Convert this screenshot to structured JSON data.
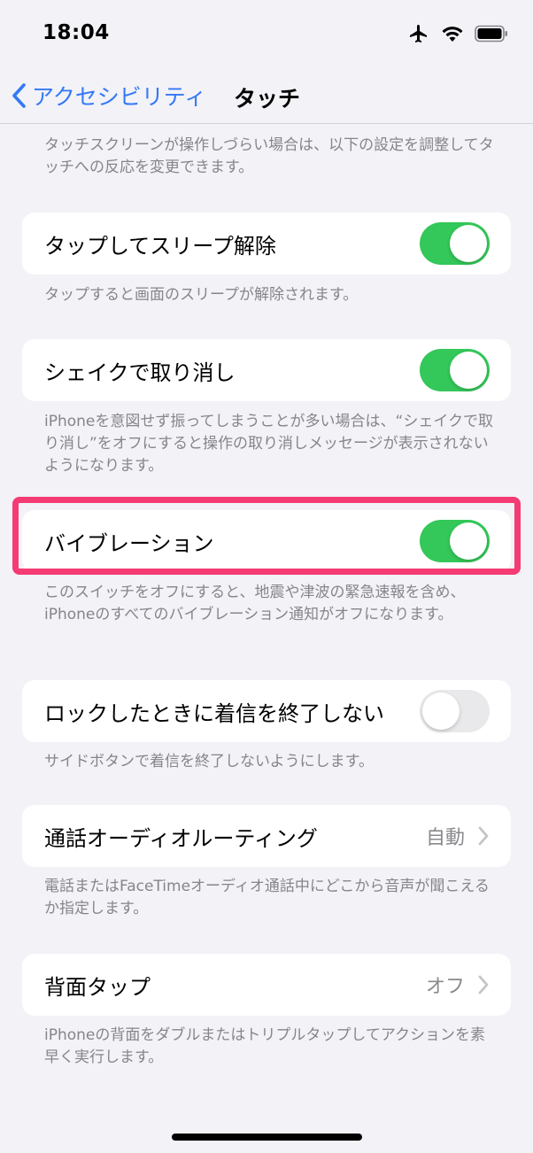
{
  "status": {
    "time": "18:04"
  },
  "nav": {
    "back_label": "アクセシビリティ",
    "title": "タッチ"
  },
  "intro": "タッチスクリーンが操作しづらい場合は、以下の設定を調整してタッチへの反応を変更できます。",
  "rows": [
    {
      "label": "タップしてスリープ解除",
      "toggle": true,
      "footer": "タップすると画面のスリープが解除されます。"
    },
    {
      "label": "シェイクで取り消し",
      "toggle": true,
      "footer": "iPhoneを意図せず振ってしまうことが多い場合は、“シェイクで取り消し”をオフにすると操作の取り消しメッセージが表示されないようになります。"
    },
    {
      "label": "バイブレーション",
      "toggle": true,
      "footer": "このスイッチをオフにすると、地震や津波の緊急速報を含め、iPhoneのすべてのバイブレーション通知がオフになります。"
    },
    {
      "label": "ロックしたときに着信を終了しない",
      "toggle": false,
      "footer": "サイドボタンで着信を終了しないようにします。"
    },
    {
      "label": "通話オーディオルーティング",
      "value": "自動",
      "footer": "電話またはFaceTimeオーディオ通話中にどこから音声が聞こえるか指定します。"
    },
    {
      "label": "背面タップ",
      "value": "オフ",
      "footer": "iPhoneの背面をダブルまたはトリプルタップしてアクションを素早く実行します。"
    }
  ],
  "colors": {
    "accent": "#3478f6",
    "toggle_on": "#34c759",
    "highlight": "#f43b73"
  }
}
